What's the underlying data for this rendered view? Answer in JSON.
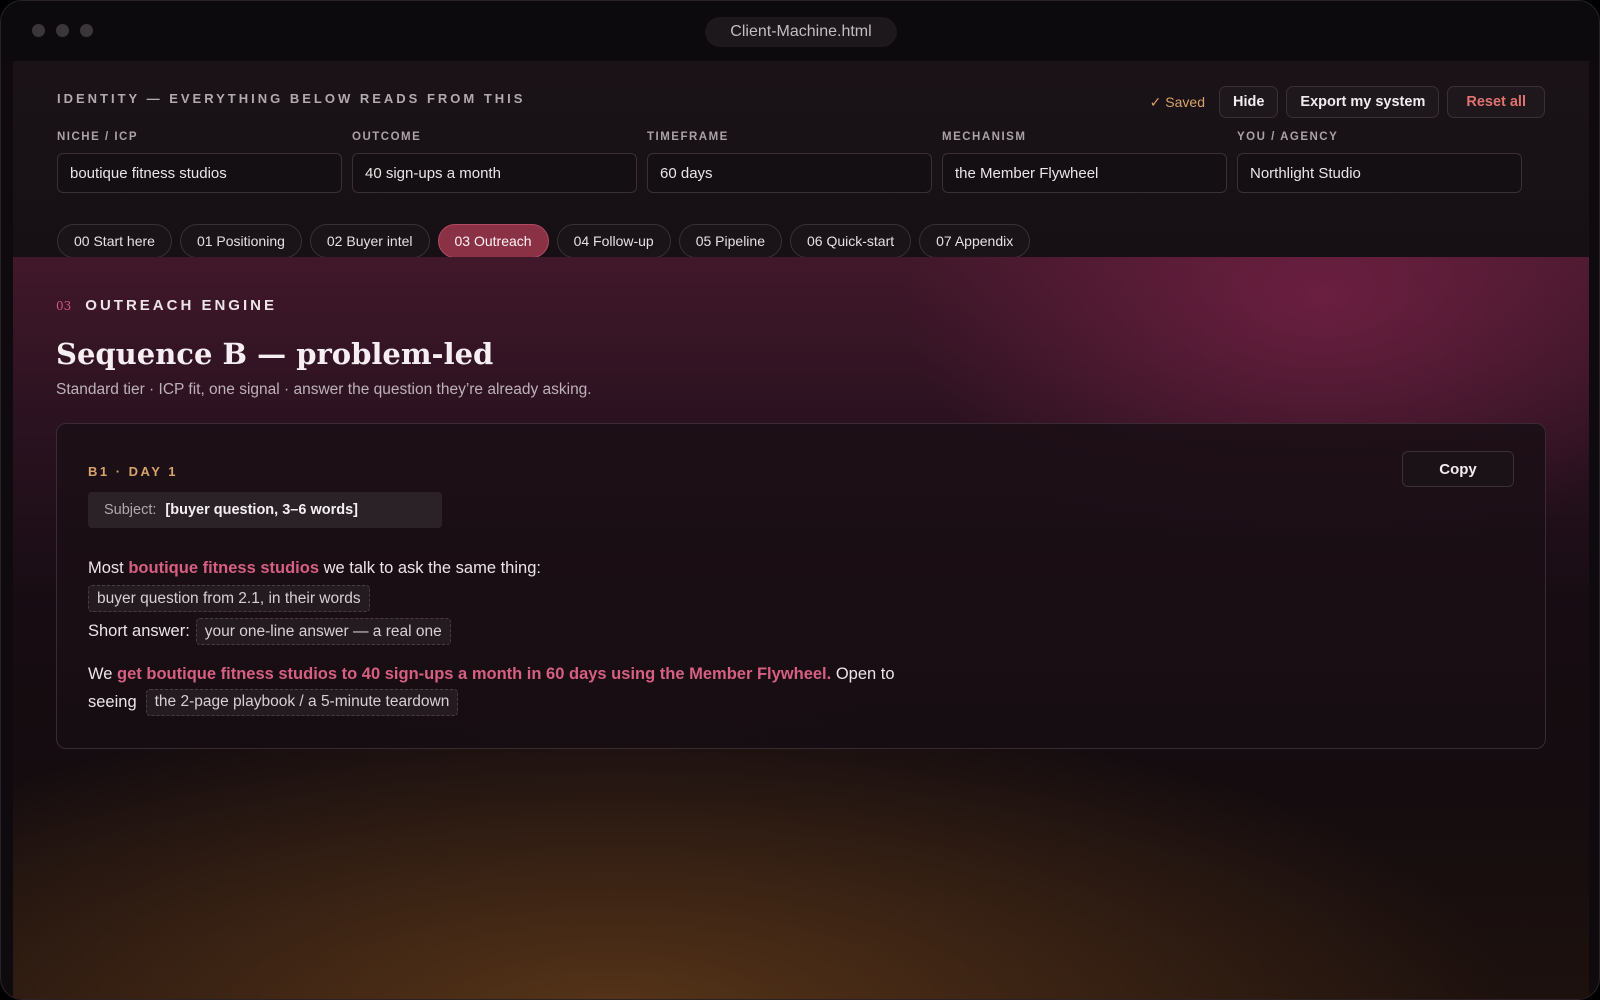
{
  "window": {
    "title": "Client-Machine.html"
  },
  "identity": {
    "heading": "IDENTITY — EVERYTHING BELOW READS FROM THIS",
    "saved_icon": "✓",
    "saved_label": "Saved",
    "hide_label": "Hide",
    "export_label": "Export my system",
    "reset_label": "Reset all",
    "fields": [
      {
        "label": "NICHE / ICP",
        "value": "boutique fitness studios"
      },
      {
        "label": "OUTCOME",
        "value": "40 sign-ups a month"
      },
      {
        "label": "TIMEFRAME",
        "value": "60 days"
      },
      {
        "label": "MECHANISM",
        "value": "the Member Flywheel"
      },
      {
        "label": "YOU / AGENCY",
        "value": "Northlight Studio"
      }
    ]
  },
  "nav": {
    "tabs": [
      {
        "label": "00 Start here"
      },
      {
        "label": "01 Positioning"
      },
      {
        "label": "02 Buyer intel"
      },
      {
        "label": "03 Outreach",
        "active": true
      },
      {
        "label": "04 Follow-up"
      },
      {
        "label": "05 Pipeline"
      },
      {
        "label": "06 Quick-start"
      },
      {
        "label": "07 Appendix"
      }
    ]
  },
  "section": {
    "number": "03",
    "name": "OUTREACH ENGINE",
    "title": "Sequence B — problem-led",
    "subtitle": "Standard tier · ICP fit, one signal · answer the question they’re already asking."
  },
  "card": {
    "step": "B1 · DAY 1",
    "copy_label": "Copy",
    "subject_label": "Subject:",
    "subject_value": "[buyer question, 3–6 words]",
    "line1_pre": "Most ",
    "line1_hl": "boutique fitness studios",
    "line1_post": " we talk to ask the same thing:",
    "placeholder_question": "buyer question from 2.1, in their words",
    "short_answer_label": "Short answer:",
    "placeholder_answer": "your one-line answer — a real one",
    "line4_pre": "We ",
    "line4_hl": "get boutique fitness studios to 40 sign-ups a month in 60 days using the Member Flywheel.",
    "line4_post": " Open to",
    "line5_pre": "seeing",
    "placeholder_offer": "the 2-page playbook / a 5-minute teardown"
  },
  "colors": {
    "accent": "#d75f82",
    "active_tab": "#8a3146",
    "gold": "#d9a46a",
    "danger": "#e0736f"
  }
}
